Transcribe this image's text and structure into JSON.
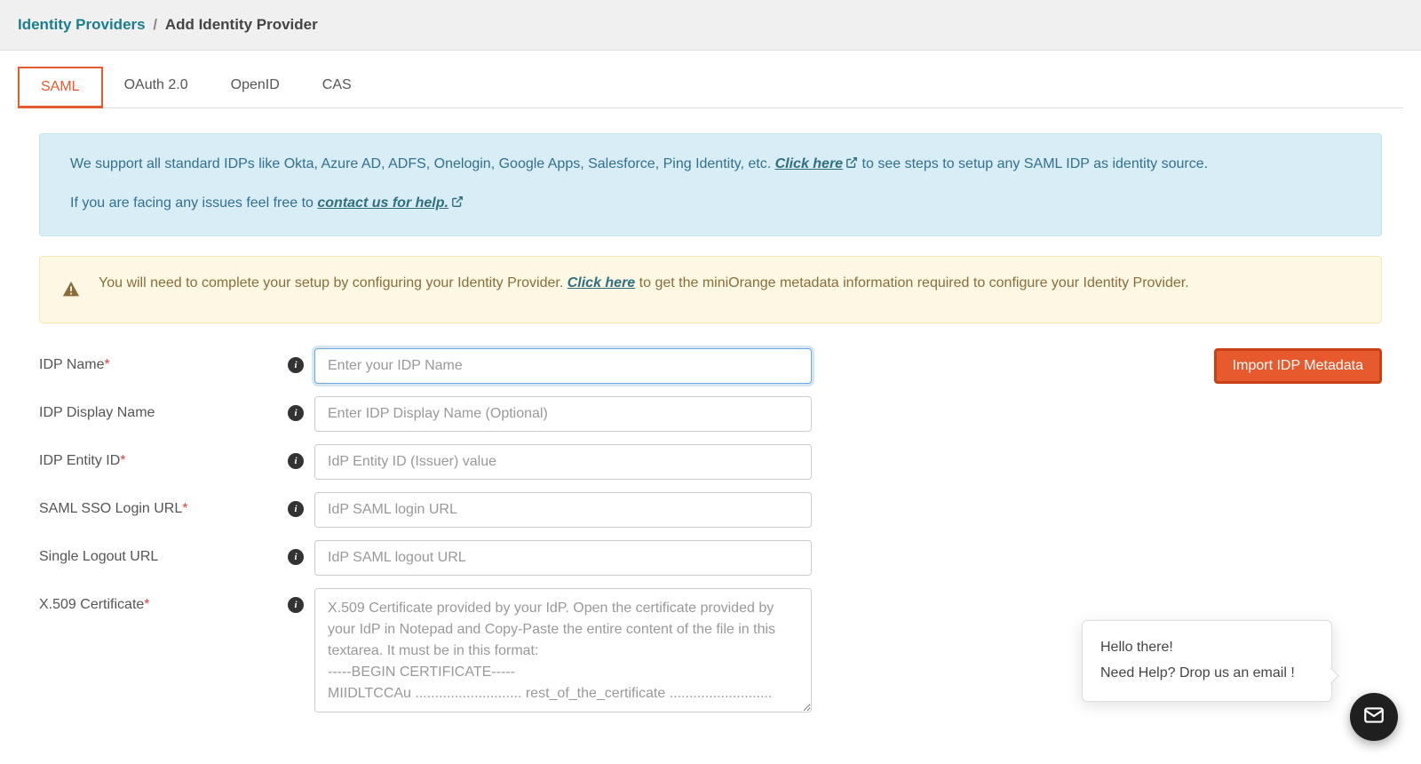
{
  "breadcrumb": {
    "root": "Identity Providers",
    "separator": "/",
    "current": "Add Identity Provider"
  },
  "tabs": [
    {
      "label": "SAML",
      "active": true
    },
    {
      "label": "OAuth 2.0",
      "active": false
    },
    {
      "label": "OpenID",
      "active": false
    },
    {
      "label": "CAS",
      "active": false
    }
  ],
  "info": {
    "text_before": "We support all standard IDPs like Okta, Azure AD, ADFS, Onelogin, Google Apps, Salesforce, Ping Identity, etc. ",
    "link1": "Click here",
    "text_after": " to see steps to setup any SAML IDP as identity source.",
    "line2_before": "If you are facing any issues feel free to ",
    "link2": "contact us for help."
  },
  "warn": {
    "text_before": "You will need to complete your setup by configuring your Identity Provider. ",
    "link": "Click here",
    "text_after": " to get the miniOrange metadata information required to configure your Identity Provider."
  },
  "form": {
    "fields": {
      "idp_name": {
        "label": "IDP Name",
        "required": true,
        "placeholder": "Enter your IDP Name"
      },
      "idp_display_name": {
        "label": "IDP Display Name",
        "required": false,
        "placeholder": "Enter IDP Display Name (Optional)"
      },
      "idp_entity_id": {
        "label": "IDP Entity ID",
        "required": true,
        "placeholder": "IdP Entity ID (Issuer) value"
      },
      "saml_sso_login_url": {
        "label": "SAML SSO Login URL",
        "required": true,
        "placeholder": "IdP SAML login URL"
      },
      "single_logout_url": {
        "label": "Single Logout URL",
        "required": false,
        "placeholder": "IdP SAML logout URL"
      },
      "x509_cert": {
        "label": "X.509 Certificate",
        "required": true,
        "placeholder": "X.509 Certificate provided by your IdP. Open the certificate provided by your IdP in Notepad and Copy-Paste the entire content of the file in this textarea. It must be in this format:\n-----BEGIN CERTIFICATE-----\nMIIDLTCCAu ........................... rest_of_the_certificate .........................."
      }
    },
    "import_btn": "Import IDP Metadata"
  },
  "help_popup": {
    "line1": "Hello there!",
    "line2": "Need Help? Drop us an email !"
  }
}
